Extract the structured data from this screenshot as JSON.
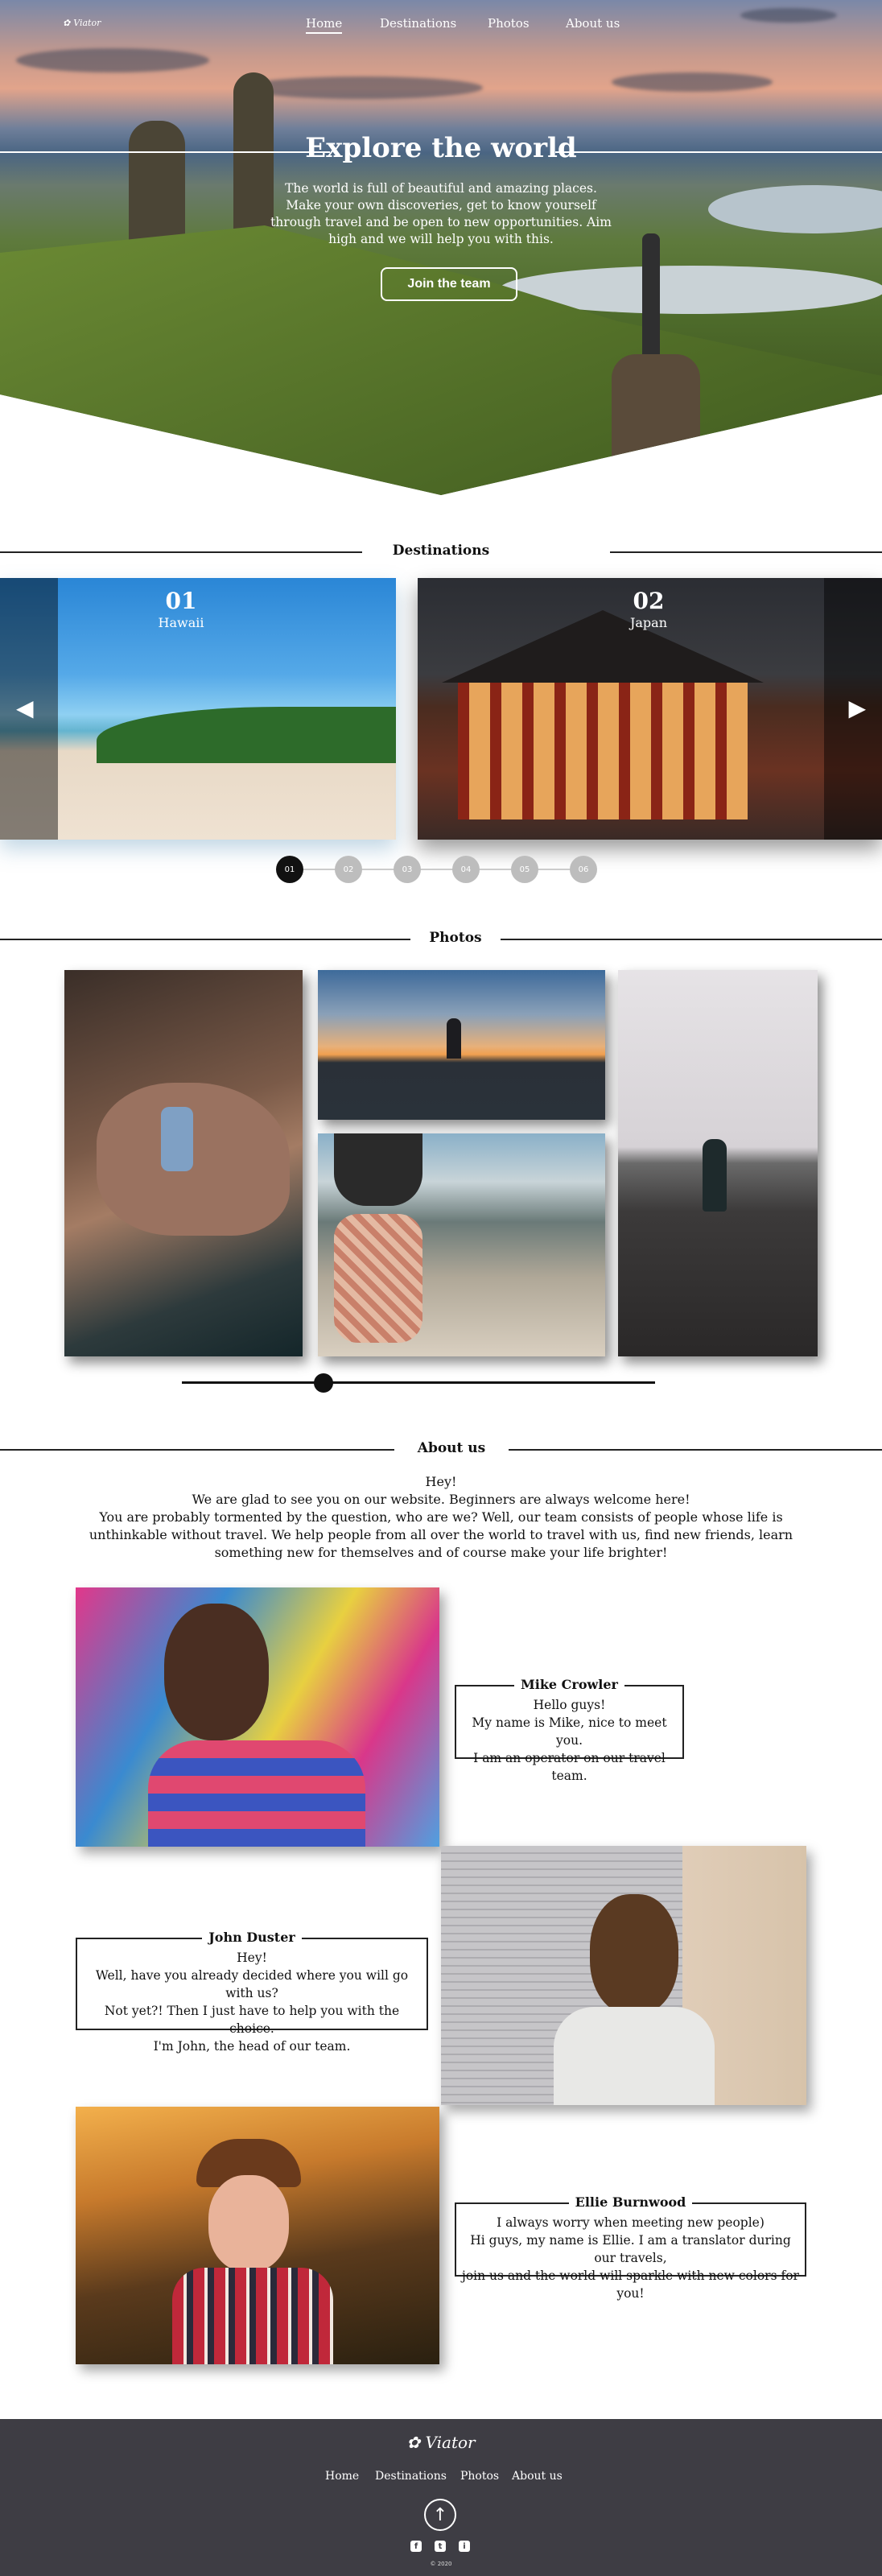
{
  "brand": {
    "name": "Viator"
  },
  "nav": {
    "items": [
      "Home",
      "Destinations",
      "Photos",
      "About us"
    ],
    "active": "Home"
  },
  "hero": {
    "title": "Explore the world",
    "subtitle": "The world is full of beautiful and amazing places. Make your own discoveries, get to know yourself through travel and be open to new opportunities. Aim high and we will help you with this.",
    "button": "Join the team"
  },
  "destinations": {
    "title": "Destinations",
    "slides": [
      {
        "number": "01",
        "place": "Hawaii"
      },
      {
        "number": "02",
        "place": "Japan"
      }
    ],
    "pagination": [
      "01",
      "02",
      "03",
      "04",
      "05",
      "06"
    ],
    "active_page": "01"
  },
  "photos": {
    "title": "Photos",
    "slider_position": 0.3
  },
  "about": {
    "title": "About us",
    "intro": [
      "Hey!",
      "We are glad to see you on our website. Beginners are always welcome here!",
      "You are probably tormented by the question, who are we? Well, our team consists of people whose life is unthinkable without travel. We help people from all over the world to travel with us, find new friends,  learn something new for themselves and of course make your life brighter!"
    ],
    "members": [
      {
        "name": "Mike Crowler",
        "lines": [
          "Hello guys!",
          "My name is Mike, nice to meet you.",
          "I am an operator on our travel team."
        ]
      },
      {
        "name": "John Duster",
        "lines": [
          "Hey!",
          "Well, have you already decided where you will go with us?",
          "Not yet?! Then I just have to help you with the choice.",
          "I'm John, the head of our team."
        ]
      },
      {
        "name": "Ellie Burnwood",
        "lines": [
          "I always worry when meeting new people)",
          "Hi guys, my name is Ellie. I am a translator during our travels,",
          "join us and the world will sparkle with new colors for you!"
        ]
      }
    ]
  },
  "footer": {
    "brand": "Viator",
    "links": [
      "Home",
      "Destinations",
      "Photos",
      "About us"
    ],
    "social": [
      "f",
      "t",
      "i"
    ],
    "copyright": "© 2020"
  },
  "colors": {
    "footer_bg": "#3e3d44",
    "accent": "#111111"
  }
}
